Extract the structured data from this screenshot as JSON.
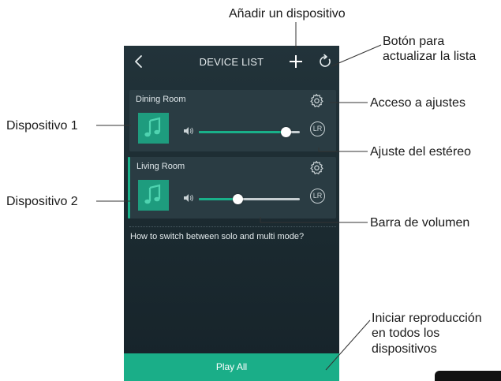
{
  "annotations": {
    "add_device": "Añadir un dispositivo",
    "refresh_line1": "Botón para",
    "refresh_line2": "actualizar la lista",
    "settings_access": "Acceso a ajustes",
    "device1": "Dispositivo 1",
    "stereo": "Ajuste del estéreo",
    "device2": "Dispositivo 2",
    "volume_bar": "Barra de volumen",
    "playall_line1": "Iniciar reproducción",
    "playall_line2": "en todos los",
    "playall_line3": "dispositivos"
  },
  "app": {
    "title": "DEVICE LIST",
    "icons": [
      "back-chevron-icon",
      "plus-icon",
      "refresh-icon",
      "gear-icon",
      "music-note-icon",
      "speaker-icon",
      "lr-stereo-icon"
    ],
    "devices": [
      {
        "name": "Dining Room",
        "volume": 0.86,
        "selected": false,
        "stereo_label": "LR"
      },
      {
        "name": "Living Room",
        "volume": 0.38,
        "selected": true,
        "stereo_label": "LR"
      }
    ],
    "help_text": "How to switch between solo and multi mode?",
    "play_all_label": "Play All"
  },
  "colors": {
    "accent": "#1aae88",
    "background_top": "#22333a",
    "card": "#2a3c43",
    "text_light": "#e6ecee"
  }
}
